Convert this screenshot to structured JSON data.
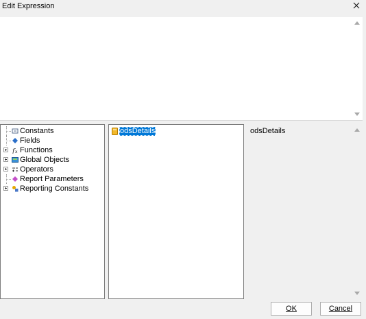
{
  "window": {
    "title": "Edit Expression"
  },
  "expression": {
    "value": ""
  },
  "tree": {
    "items": [
      {
        "label": "Constants",
        "icon": "constants-icon",
        "expandable": false
      },
      {
        "label": "Fields",
        "icon": "fields-icon",
        "expandable": false
      },
      {
        "label": "Functions",
        "icon": "functions-icon",
        "expandable": true
      },
      {
        "label": "Global Objects",
        "icon": "global-objects-icon",
        "expandable": true
      },
      {
        "label": "Operators",
        "icon": "operators-icon",
        "expandable": true
      },
      {
        "label": "Report Parameters",
        "icon": "report-parameters-icon",
        "expandable": false
      },
      {
        "label": "Reporting Constants",
        "icon": "reporting-constants-icon",
        "expandable": true
      }
    ]
  },
  "fields": {
    "items": [
      {
        "label": "odsDetails",
        "selected": true
      }
    ]
  },
  "description": {
    "text": "odsDetails"
  },
  "buttons": {
    "ok": "OK",
    "cancel": "Cancel"
  },
  "colors": {
    "selection": "#0078d7",
    "window": "#f0f0f0"
  }
}
